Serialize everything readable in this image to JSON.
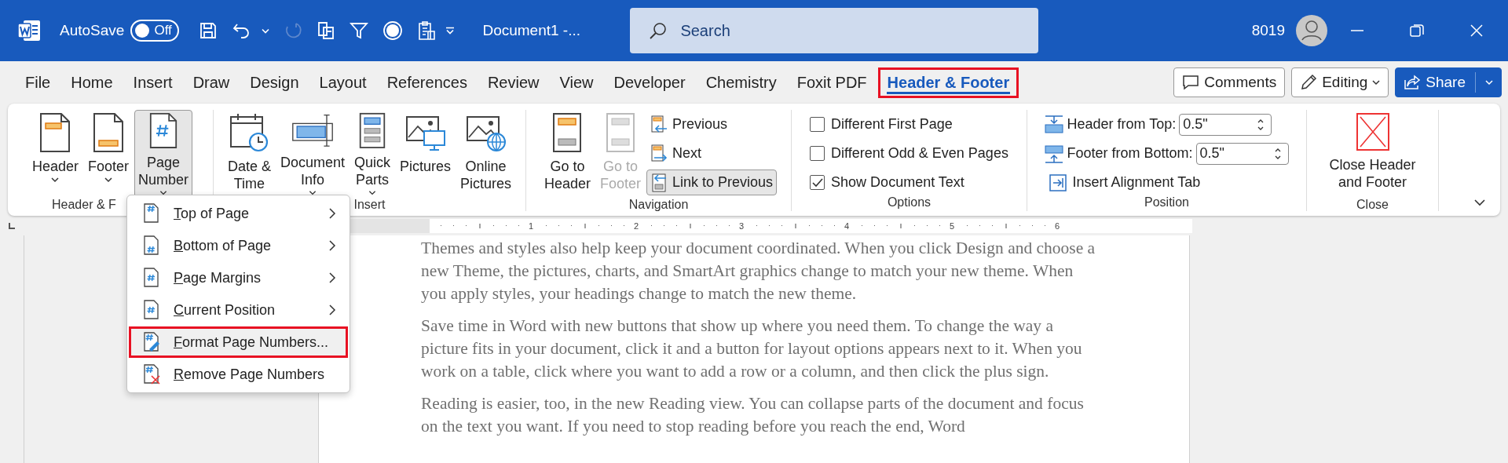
{
  "title_bar": {
    "autosave": {
      "label": "AutoSave",
      "on": false,
      "state_text": "Off"
    },
    "document_title": "Document1  -...",
    "search": {
      "placeholder": "Search"
    },
    "user": "8019"
  },
  "tabs": [
    {
      "label": "File",
      "selected": false,
      "highlighted": false
    },
    {
      "label": "Home",
      "selected": false,
      "highlighted": false
    },
    {
      "label": "Insert",
      "selected": false,
      "highlighted": false
    },
    {
      "label": "Draw",
      "selected": false,
      "highlighted": false
    },
    {
      "label": "Design",
      "selected": false,
      "highlighted": false
    },
    {
      "label": "Layout",
      "selected": false,
      "highlighted": false
    },
    {
      "label": "References",
      "selected": false,
      "highlighted": false
    },
    {
      "label": "Review",
      "selected": false,
      "highlighted": false
    },
    {
      "label": "View",
      "selected": false,
      "highlighted": false
    },
    {
      "label": "Developer",
      "selected": false,
      "highlighted": false
    },
    {
      "label": "Chemistry",
      "selected": false,
      "highlighted": false
    },
    {
      "label": "Foxit PDF",
      "selected": false,
      "highlighted": false
    },
    {
      "label": "Header & Footer",
      "selected": true,
      "highlighted": true
    }
  ],
  "actions": [
    {
      "label": "Comments",
      "kind": "comments"
    },
    {
      "label": "Editing",
      "kind": "editing"
    },
    {
      "label": "Share",
      "kind": "share"
    }
  ],
  "ribbon": {
    "groups": [
      {
        "label": "Header & F",
        "items": [
          {
            "kind": "large",
            "label": "Header",
            "caret": true,
            "selected": false,
            "disabled": false
          },
          {
            "kind": "large",
            "label": "Footer",
            "caret": true,
            "selected": false,
            "disabled": false
          },
          {
            "kind": "large",
            "label": "Page\nNumber",
            "caret": true,
            "selected": true,
            "disabled": false
          }
        ]
      },
      {
        "label": "Insert",
        "items": [
          {
            "kind": "large",
            "label": "Date &\nTime",
            "caret": false,
            "selected": false,
            "disabled": false
          },
          {
            "kind": "large",
            "label": "Document\nInfo",
            "caret": true,
            "selected": false,
            "disabled": false
          },
          {
            "kind": "large",
            "label": "Quick\nParts",
            "caret": true,
            "selected": false,
            "disabled": false
          },
          {
            "kind": "large",
            "label": "Pictures",
            "caret": false,
            "selected": false,
            "disabled": false
          },
          {
            "kind": "large",
            "label": "Online\nPictures",
            "caret": false,
            "selected": false,
            "disabled": false
          }
        ]
      },
      {
        "label": "Navigation",
        "items": [
          {
            "kind": "large",
            "label": "Go to\nHeader",
            "caret": false,
            "selected": false,
            "disabled": false
          },
          {
            "kind": "large",
            "label": "Go to\nFooter",
            "caret": false,
            "selected": false,
            "disabled": true
          },
          {
            "kind": "small",
            "label": "Previous",
            "selected": false
          },
          {
            "kind": "small",
            "label": "Next",
            "selected": false
          },
          {
            "kind": "small",
            "label": "Link to Previous",
            "selected": true
          }
        ]
      },
      {
        "label": "Options",
        "items": [
          {
            "kind": "checkbox",
            "label": "Different First Page",
            "checked": false
          },
          {
            "kind": "checkbox",
            "label": "Different Odd & Even Pages",
            "checked": false
          },
          {
            "kind": "checkbox",
            "label": "Show Document Text",
            "checked": true
          }
        ]
      },
      {
        "label": "Position",
        "items": [
          {
            "kind": "spin",
            "label": "Header from Top:",
            "value": "0.5\""
          },
          {
            "kind": "spin",
            "label": "Footer from Bottom:",
            "value": "0.5\""
          },
          {
            "kind": "small",
            "label": "Insert Alignment Tab",
            "selected": false
          }
        ]
      },
      {
        "label": "Close",
        "items": [
          {
            "kind": "large",
            "label": "Close Header\nand Footer",
            "caret": false,
            "selected": false,
            "disabled": false
          }
        ]
      }
    ]
  },
  "ruler": {
    "numbers": [
      "1",
      "2",
      "3",
      "4",
      "5",
      "6"
    ]
  },
  "document": {
    "paragraphs": [
      "Themes and styles also help keep your document coordinated. When you click Design and choose a new Theme, the pictures, charts, and SmartArt graphics change to match your new theme. When you apply styles, your headings change to match the new theme.",
      "Save time in Word with new buttons that show up where you need them. To change the way a picture fits in your document, click it and a button for layout options appears next to it. When you work on a table, click where you want to add a row or a column, and then click the plus sign.",
      "Reading is easier, too, in the new Reading view. You can collapse parts of the document and focus on the text you want. If you need to stop reading before you reach the end, Word"
    ]
  },
  "menu": {
    "items": [
      {
        "label": "Top of Page",
        "submenu": true,
        "highlighted": false
      },
      {
        "label": "Bottom of Page",
        "submenu": true,
        "highlighted": false
      },
      {
        "label": "Page Margins",
        "submenu": true,
        "highlighted": false
      },
      {
        "label": "Current Position",
        "submenu": true,
        "highlighted": false
      },
      {
        "label": "Format Page Numbers...",
        "submenu": false,
        "highlighted": true
      },
      {
        "label": "Remove Page Numbers",
        "submenu": false,
        "highlighted": false
      }
    ]
  }
}
